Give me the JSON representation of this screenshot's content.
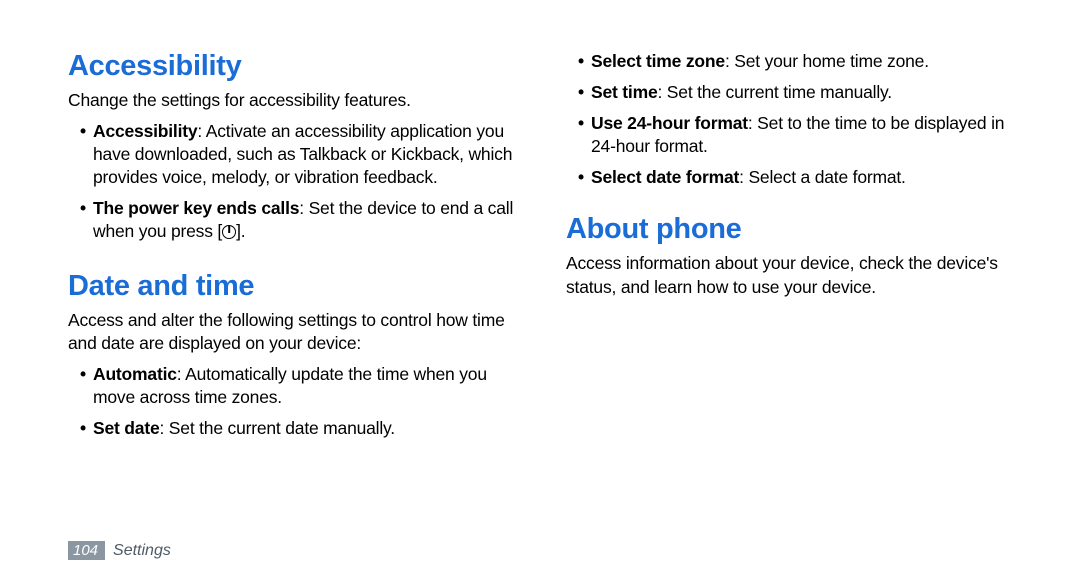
{
  "left": {
    "accessibility": {
      "heading": "Accessibility",
      "desc": "Change the settings for accessibility features.",
      "items": [
        {
          "bold": "Accessibility",
          "rest": ": Activate an accessibility application you have downloaded, such as Talkback or Kickback, which provides voice, melody, or vibration feedback."
        },
        {
          "bold": "The power key ends calls",
          "rest": ": Set the device to end a call when you press [",
          "hasPowerIcon": true,
          "tail": "]."
        }
      ]
    },
    "datetime": {
      "heading": "Date and time",
      "desc": "Access and alter the following settings to control how time and date are displayed on your device:",
      "items": [
        {
          "bold": "Automatic",
          "rest": ": Automatically update the time when you move across time zones."
        },
        {
          "bold": "Set date",
          "rest": ": Set the current date manually."
        }
      ]
    }
  },
  "right": {
    "more_time_items": [
      {
        "bold": "Select time zone",
        "rest": ": Set your home time zone."
      },
      {
        "bold": "Set time",
        "rest": ": Set the current time manually."
      },
      {
        "bold": "Use 24-hour format",
        "rest": ": Set to the time to be displayed in 24-hour format."
      },
      {
        "bold": "Select date format",
        "rest": ": Select a date format."
      }
    ],
    "about": {
      "heading": "About phone",
      "desc": "Access information about your device, check the device's status, and learn how to use your device."
    }
  },
  "footer": {
    "page": "104",
    "section": "Settings"
  }
}
